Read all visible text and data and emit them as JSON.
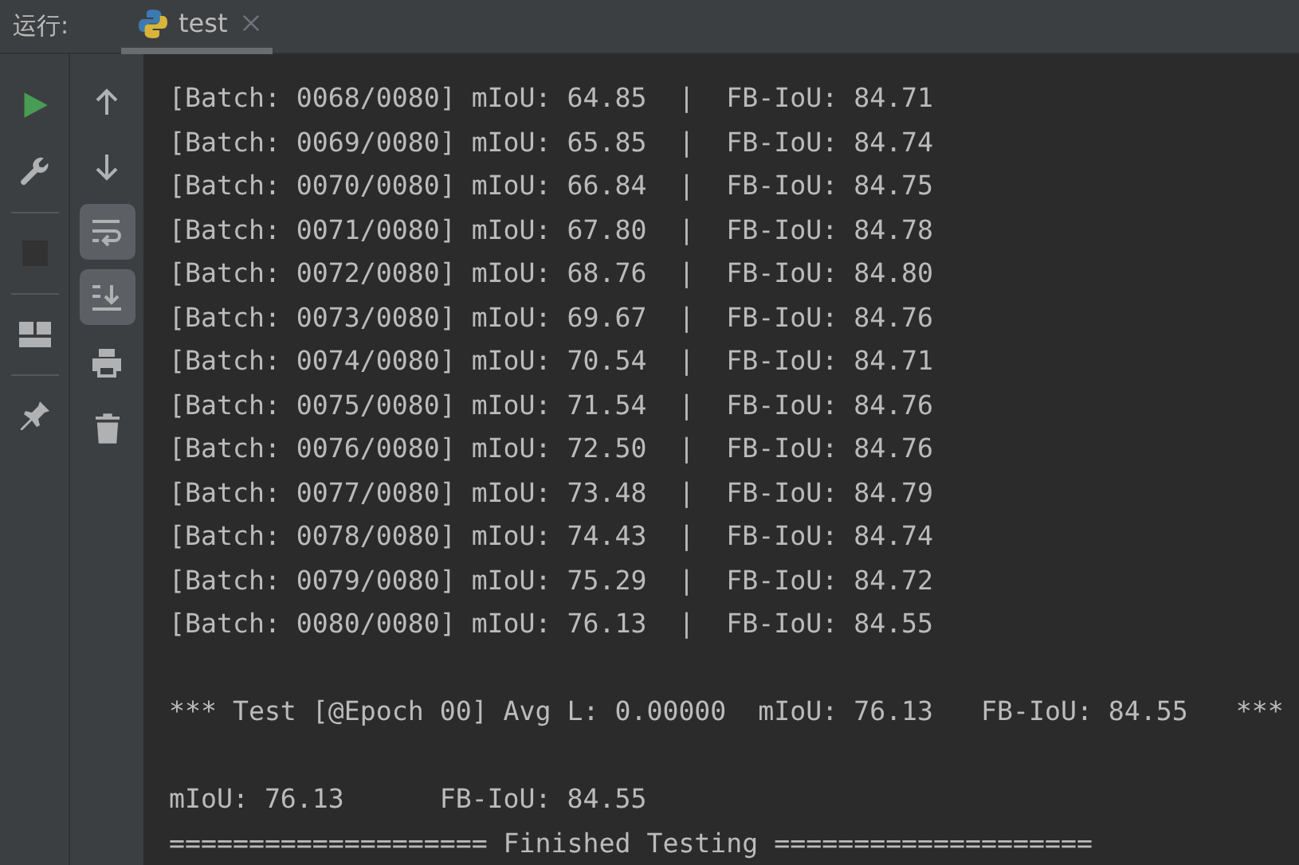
{
  "run_panel": {
    "label": "运行:",
    "tabs": [
      {
        "title": "test",
        "selected": true
      }
    ]
  },
  "left_toolbar": [
    {
      "kind": "run",
      "disabled": false
    },
    {
      "kind": "settings",
      "disabled": false
    },
    {
      "kind": "stop",
      "disabled": true
    },
    {
      "kind": "layout",
      "disabled": false
    },
    {
      "kind": "pin",
      "disabled": false
    }
  ],
  "console_toolbar": [
    {
      "kind": "up",
      "on": false
    },
    {
      "kind": "down",
      "on": false
    },
    {
      "kind": "wrap",
      "on": true
    },
    {
      "kind": "scroll_end",
      "on": true
    },
    {
      "kind": "print",
      "on": false
    },
    {
      "kind": "trash",
      "on": false
    }
  ],
  "console": [
    {
      "kind": "batch",
      "text": "[Batch: 0068/0080] mIoU: 64.85  |  FB-IoU: 84.71"
    },
    {
      "kind": "batch",
      "text": "[Batch: 0069/0080] mIoU: 65.85  |  FB-IoU: 84.74"
    },
    {
      "kind": "batch",
      "text": "[Batch: 0070/0080] mIoU: 66.84  |  FB-IoU: 84.75"
    },
    {
      "kind": "batch",
      "text": "[Batch: 0071/0080] mIoU: 67.80  |  FB-IoU: 84.78"
    },
    {
      "kind": "batch",
      "text": "[Batch: 0072/0080] mIoU: 68.76  |  FB-IoU: 84.80"
    },
    {
      "kind": "batch",
      "text": "[Batch: 0073/0080] mIoU: 69.67  |  FB-IoU: 84.76"
    },
    {
      "kind": "batch",
      "text": "[Batch: 0074/0080] mIoU: 70.54  |  FB-IoU: 84.71"
    },
    {
      "kind": "batch",
      "text": "[Batch: 0075/0080] mIoU: 71.54  |  FB-IoU: 84.76"
    },
    {
      "kind": "batch",
      "text": "[Batch: 0076/0080] mIoU: 72.50  |  FB-IoU: 84.76"
    },
    {
      "kind": "batch",
      "text": "[Batch: 0077/0080] mIoU: 73.48  |  FB-IoU: 84.79"
    },
    {
      "kind": "batch",
      "text": "[Batch: 0078/0080] mIoU: 74.43  |  FB-IoU: 84.74"
    },
    {
      "kind": "batch",
      "text": "[Batch: 0079/0080] mIoU: 75.29  |  FB-IoU: 84.72"
    },
    {
      "kind": "batch",
      "text": "[Batch: 0080/0080] mIoU: 76.13  |  FB-IoU: 84.55"
    },
    {
      "kind": "summary",
      "text": "*** Test [@Epoch 00] Avg L: 0.00000  mIoU: 76.13   FB-IoU: 84.55   ***"
    },
    {
      "kind": "summary",
      "text": "mIoU: 76.13      FB-IoU: 84.55"
    },
    {
      "kind": "banner",
      "text": "==================== Finished Testing ===================="
    }
  ]
}
